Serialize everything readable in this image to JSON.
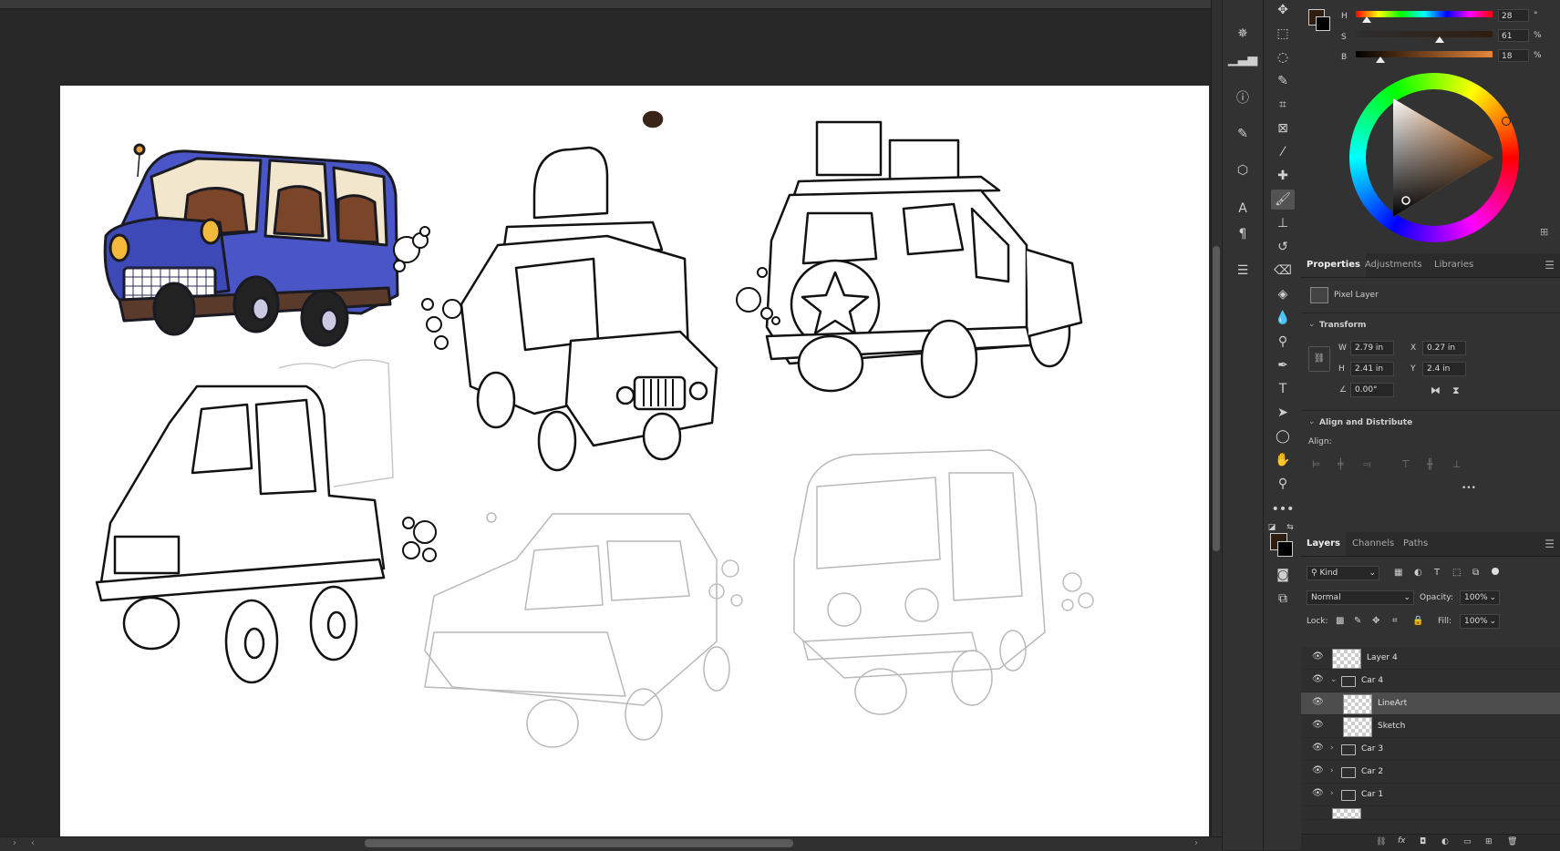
{
  "color_panel": {
    "h_label": "H",
    "s_label": "S",
    "b_label": "B",
    "h_value": "28",
    "s_value": "61",
    "b_value": "18",
    "h_unit": "°",
    "s_unit": "%",
    "b_unit": "%",
    "h_level": 0.078,
    "s_level": 0.61,
    "b_level": 0.18,
    "foreground_color": "#2e1e12",
    "background_color": "#000000"
  },
  "properties_tabs": [
    {
      "label": "Properties"
    },
    {
      "label": "Adjustments"
    },
    {
      "label": "Libraries"
    }
  ],
  "properties": {
    "layer_kind": "Pixel Layer",
    "transform_title": "Transform",
    "w_label": "W",
    "w_value": "2.79 in",
    "x_label": "X",
    "x_value": "0.27 in",
    "h_label": "H",
    "h_value": "2.41 in",
    "y_label": "Y",
    "y_value": "2.4 in",
    "angle_value": "0.00°",
    "align_title": "Align and Distribute",
    "align_label": "Align:",
    "more": "•••"
  },
  "layers_tabs": [
    {
      "label": "Layers"
    },
    {
      "label": "Channels"
    },
    {
      "label": "Paths"
    }
  ],
  "layers_panel": {
    "filter_kind": "Kind",
    "blend_mode": "Normal",
    "opacity_label": "Opacity:",
    "opacity_value": "100%",
    "lock_label": "Lock:",
    "fill_label": "Fill:",
    "fill_value": "100%",
    "layers": [
      {
        "name": "Layer 4"
      },
      {
        "name": "Car 4"
      },
      {
        "name": "LineArt"
      },
      {
        "name": "Sketch"
      },
      {
        "name": "Car 3"
      },
      {
        "name": "Car 2"
      },
      {
        "name": "Car 1"
      }
    ]
  },
  "colors": {
    "car_blue": "#4a55c8",
    "panel_bg": "#323232",
    "workspace_bg": "#282828"
  }
}
